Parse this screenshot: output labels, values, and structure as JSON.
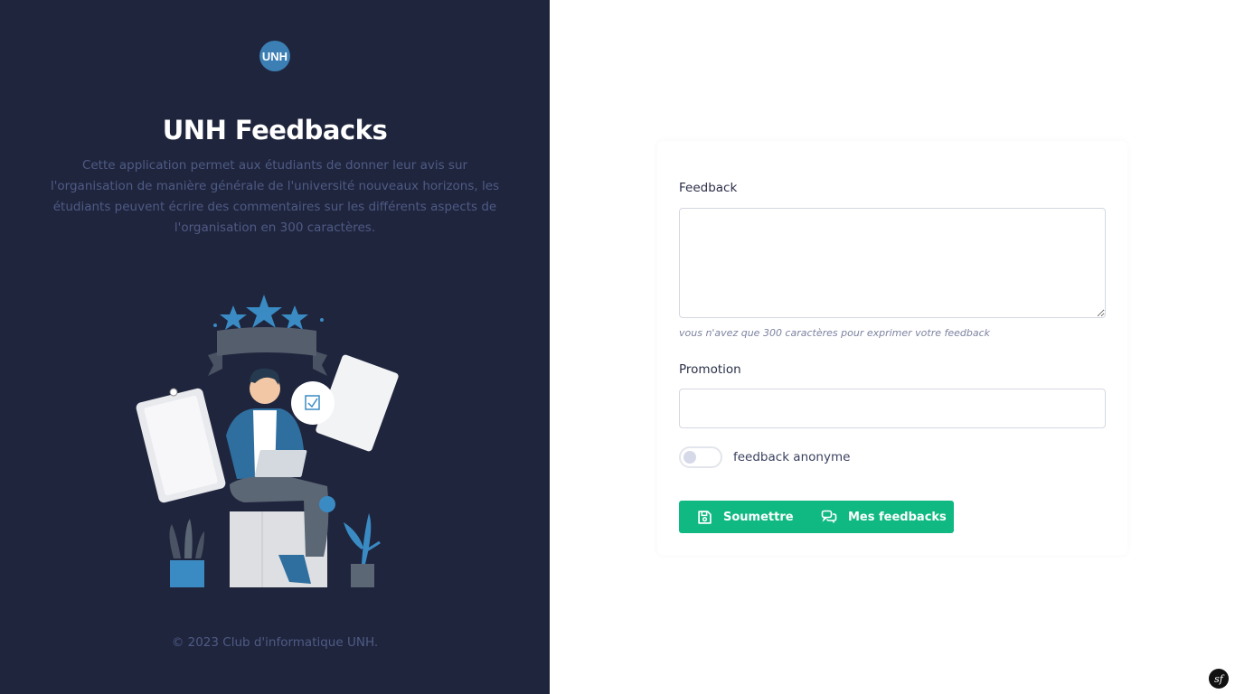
{
  "app": {
    "logo_text": "UNH",
    "title": "UNH Feedbacks",
    "description": "Cette application permet aux étudiants de donner leur avis sur l'organisation de manière générale de l'université nouveaux horizons, les étudiants peuvent écrire des commentaires sur les différents aspects de l'organisation en 300 caractères.",
    "copyright": "© 2023 Club d'informatique UNH."
  },
  "form": {
    "feedback_label": "Feedback",
    "feedback_value": "",
    "feedback_help": "vous n'avez que 300 caractères pour exprimer votre feedback",
    "promotion_label": "Promotion",
    "promotion_value": "",
    "anonymous_label": "feedback anonyme",
    "anonymous_checked": false,
    "submit_label": "Soumettre",
    "my_feedbacks_label": "Mes feedbacks"
  },
  "colors": {
    "sidebar_bg": "#1f253d",
    "accent": "#10b982",
    "logo_bg": "#3b7fb4"
  },
  "icons": {
    "submit": "save-icon",
    "my_feedbacks": "chat-bubbles-icon",
    "debug": "symfony-icon"
  }
}
